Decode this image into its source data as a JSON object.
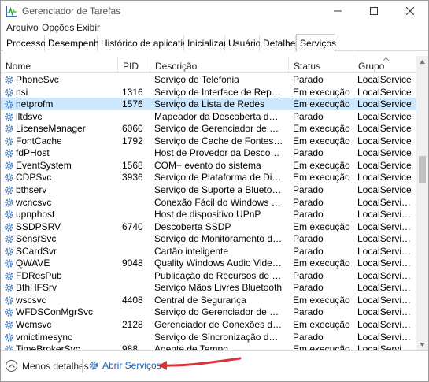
{
  "window": {
    "title": "Gerenciador de Tarefas"
  },
  "menu": [
    "Arquivo",
    "Opções",
    "Exibir"
  ],
  "tabs": [
    {
      "label": "Processos"
    },
    {
      "label": "Desempenho"
    },
    {
      "label": "Histórico de aplicativos"
    },
    {
      "label": "Inicializar"
    },
    {
      "label": "Usuários"
    },
    {
      "label": "Detalhes"
    },
    {
      "label": "Serviços",
      "active": true
    }
  ],
  "columns": {
    "name": "Nome",
    "pid": "PID",
    "description": "Descrição",
    "status": "Status",
    "group": "Grupo"
  },
  "services": [
    {
      "name": "PhoneSvc",
      "pid": "",
      "description": "Serviço de Telefonia",
      "status": "Parado",
      "group": "LocalService"
    },
    {
      "name": "nsi",
      "pid": "1316",
      "description": "Serviço de Interface de Repositório d...",
      "status": "Em execução",
      "group": "LocalService"
    },
    {
      "name": "netprofm",
      "pid": "1576",
      "description": "Serviço da Lista de Redes",
      "status": "Em execução",
      "group": "LocalService",
      "selected": true
    },
    {
      "name": "lltdsvc",
      "pid": "",
      "description": "Mapeador da Descoberta de Topolo...",
      "status": "Parado",
      "group": "LocalService"
    },
    {
      "name": "LicenseManager",
      "pid": "6060",
      "description": "Serviço de Gerenciador de Licença d...",
      "status": "Em execução",
      "group": "LocalService"
    },
    {
      "name": "FontCache",
      "pid": "1792",
      "description": "Serviço de Cache de Fontes do Wind...",
      "status": "Em execução",
      "group": "LocalService"
    },
    {
      "name": "fdPHost",
      "pid": "",
      "description": "Host de Provedor da Descoberta de ...",
      "status": "Parado",
      "group": "LocalService"
    },
    {
      "name": "EventSystem",
      "pid": "1568",
      "description": "COM+ evento do sistema",
      "status": "Em execução",
      "group": "LocalService"
    },
    {
      "name": "CDPSvc",
      "pid": "3936",
      "description": "Serviço de Plataforma de Dispositivo...",
      "status": "Em execução",
      "group": "LocalService"
    },
    {
      "name": "bthserv",
      "pid": "",
      "description": "Serviço de Suporte a Bluetooth",
      "status": "Parado",
      "group": "LocalService"
    },
    {
      "name": "wcncsvc",
      "pid": "",
      "description": "Conexão Fácil do Windows - Registr...",
      "status": "Parado",
      "group": "LocalServiceA..."
    },
    {
      "name": "upnphost",
      "pid": "",
      "description": "Host de dispositivo UPnP",
      "status": "Parado",
      "group": "LocalServiceA..."
    },
    {
      "name": "SSDPSRV",
      "pid": "6740",
      "description": "Descoberta SSDP",
      "status": "Em execução",
      "group": "LocalServiceA..."
    },
    {
      "name": "SensrSvc",
      "pid": "",
      "description": "Serviço de Monitoramento de Sensor",
      "status": "Parado",
      "group": "LocalServiceA..."
    },
    {
      "name": "SCardSvr",
      "pid": "",
      "description": "Cartão inteligente",
      "status": "Parado",
      "group": "LocalServiceA..."
    },
    {
      "name": "QWAVE",
      "pid": "9048",
      "description": "Quality Windows Audio Video Experi...",
      "status": "Em execução",
      "group": "LocalServiceA..."
    },
    {
      "name": "FDResPub",
      "pid": "",
      "description": "Publicação de Recursos de Descober...",
      "status": "Parado",
      "group": "LocalServiceA..."
    },
    {
      "name": "BthHFSrv",
      "pid": "",
      "description": "Serviço Mãos Livres Bluetooth",
      "status": "Parado",
      "group": "LocalServiceA..."
    },
    {
      "name": "wscsvc",
      "pid": "4408",
      "description": "Central de Segurança",
      "status": "Em execução",
      "group": "LocalServiceN..."
    },
    {
      "name": "WFDSConMgrSvc",
      "pid": "",
      "description": "Serviço do Gerenciador de Conexões...",
      "status": "Parado",
      "group": "LocalServiceN..."
    },
    {
      "name": "Wcmsvc",
      "pid": "2128",
      "description": "Gerenciador de Conexões do Windo...",
      "status": "Em execução",
      "group": "LocalServiceN..."
    },
    {
      "name": "vmictimesync",
      "pid": "",
      "description": "Serviço de Sincronização de Data/H...",
      "status": "Parado",
      "group": "LocalServiceN..."
    },
    {
      "name": "TimeBrokerSvc",
      "pid": "988",
      "description": "Agente de Tempo",
      "status": "Em execução",
      "group": "LocalServiceN..."
    }
  ],
  "footer": {
    "fewer_details": "Menos detalhes",
    "open_services": "Abrir Serviços"
  },
  "colors": {
    "selected_row": "#cce8ff",
    "link": "#1a5fb4",
    "annotation_arrow": "#d9343a"
  }
}
